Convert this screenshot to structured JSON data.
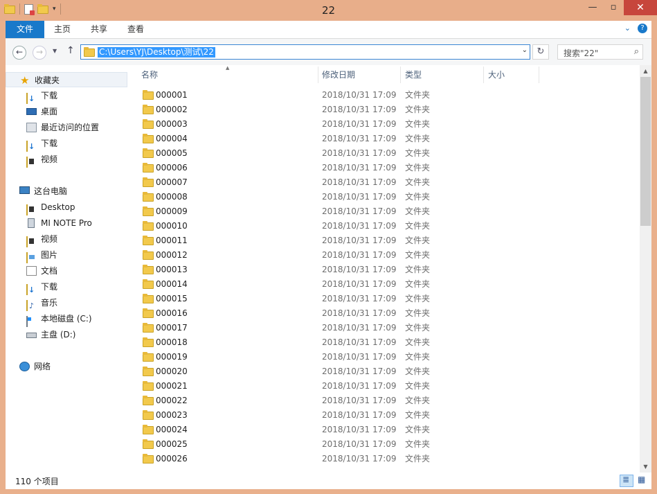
{
  "window": {
    "title": "22"
  },
  "ribbon": {
    "tabs": [
      "文件",
      "主页",
      "共享",
      "查看"
    ]
  },
  "nav": {
    "address": "C:\\Users\\YJ\\Desktop\\测试\\22",
    "search_placeholder": "搜索\"22\""
  },
  "sidebar": {
    "favorites": {
      "label": "收藏夹",
      "items": [
        "下载",
        "桌面",
        "最近访问的位置",
        "下载",
        "视频"
      ]
    },
    "pc": {
      "label": "这台电脑",
      "items": [
        "Desktop",
        "MI NOTE Pro",
        "视频",
        "图片",
        "文档",
        "下载",
        "音乐",
        "本地磁盘 (C:)",
        "主盘 (D:)"
      ]
    },
    "network": {
      "label": "网络"
    }
  },
  "columns": {
    "name": "名称",
    "modified": "修改日期",
    "type": "类型",
    "size": "大小"
  },
  "files": [
    {
      "name": "000001",
      "modified": "2018/10/31 17:09",
      "type": "文件夹"
    },
    {
      "name": "000002",
      "modified": "2018/10/31 17:09",
      "type": "文件夹"
    },
    {
      "name": "000003",
      "modified": "2018/10/31 17:09",
      "type": "文件夹"
    },
    {
      "name": "000004",
      "modified": "2018/10/31 17:09",
      "type": "文件夹"
    },
    {
      "name": "000005",
      "modified": "2018/10/31 17:09",
      "type": "文件夹"
    },
    {
      "name": "000006",
      "modified": "2018/10/31 17:09",
      "type": "文件夹"
    },
    {
      "name": "000007",
      "modified": "2018/10/31 17:09",
      "type": "文件夹"
    },
    {
      "name": "000008",
      "modified": "2018/10/31 17:09",
      "type": "文件夹"
    },
    {
      "name": "000009",
      "modified": "2018/10/31 17:09",
      "type": "文件夹"
    },
    {
      "name": "000010",
      "modified": "2018/10/31 17:09",
      "type": "文件夹"
    },
    {
      "name": "000011",
      "modified": "2018/10/31 17:09",
      "type": "文件夹"
    },
    {
      "name": "000012",
      "modified": "2018/10/31 17:09",
      "type": "文件夹"
    },
    {
      "name": "000013",
      "modified": "2018/10/31 17:09",
      "type": "文件夹"
    },
    {
      "name": "000014",
      "modified": "2018/10/31 17:09",
      "type": "文件夹"
    },
    {
      "name": "000015",
      "modified": "2018/10/31 17:09",
      "type": "文件夹"
    },
    {
      "name": "000016",
      "modified": "2018/10/31 17:09",
      "type": "文件夹"
    },
    {
      "name": "000017",
      "modified": "2018/10/31 17:09",
      "type": "文件夹"
    },
    {
      "name": "000018",
      "modified": "2018/10/31 17:09",
      "type": "文件夹"
    },
    {
      "name": "000019",
      "modified": "2018/10/31 17:09",
      "type": "文件夹"
    },
    {
      "name": "000020",
      "modified": "2018/10/31 17:09",
      "type": "文件夹"
    },
    {
      "name": "000021",
      "modified": "2018/10/31 17:09",
      "type": "文件夹"
    },
    {
      "name": "000022",
      "modified": "2018/10/31 17:09",
      "type": "文件夹"
    },
    {
      "name": "000023",
      "modified": "2018/10/31 17:09",
      "type": "文件夹"
    },
    {
      "name": "000024",
      "modified": "2018/10/31 17:09",
      "type": "文件夹"
    },
    {
      "name": "000025",
      "modified": "2018/10/31 17:09",
      "type": "文件夹"
    },
    {
      "name": "000026",
      "modified": "2018/10/31 17:09",
      "type": "文件夹"
    }
  ],
  "status": {
    "count": "110 个项目"
  },
  "colors": {
    "accent": "#1979ca",
    "titlebar": "#e8ae8a",
    "close": "#c7463c",
    "selection": "#3399ff"
  },
  "icons": {
    "folder": "folder-icon",
    "back": "back-arrow-icon",
    "forward": "forward-arrow-icon",
    "up": "up-arrow-icon",
    "refresh": "refresh-icon",
    "search": "search-icon"
  }
}
